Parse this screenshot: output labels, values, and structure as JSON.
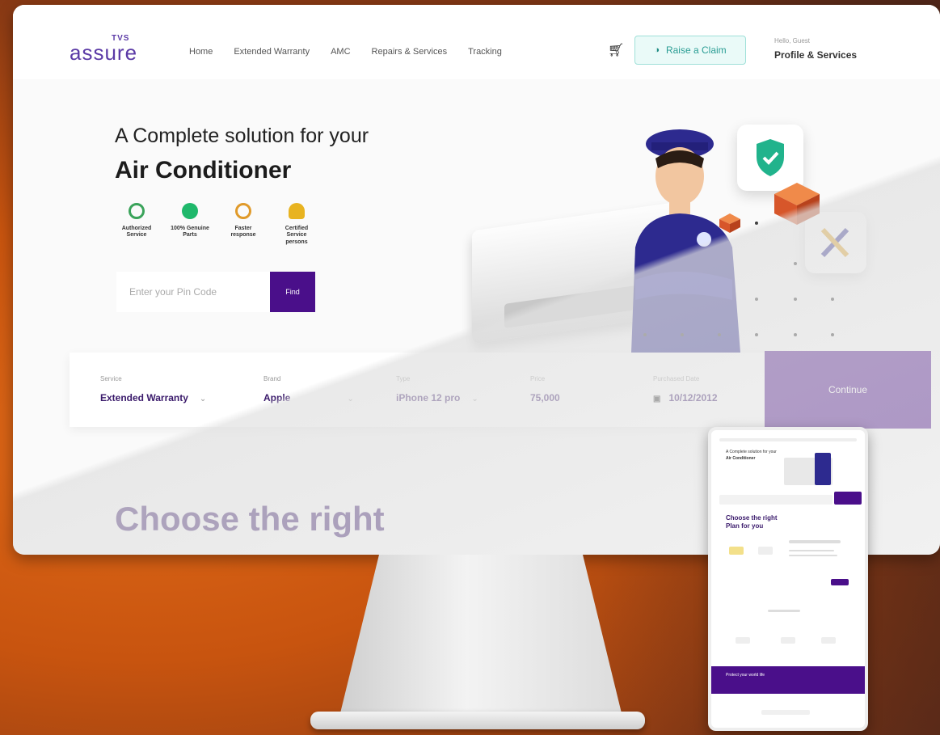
{
  "nav": {
    "logo_top": "TVS",
    "logo_main": "assure",
    "links": [
      "Home",
      "Extended Warranty",
      "AMC",
      "Repairs & Services",
      "Tracking"
    ],
    "claim_label": "Raise a Claim",
    "profile_hello": "Hello, Guest",
    "profile_label": "Profile & Services"
  },
  "hero": {
    "line1": "A Complete solution for your",
    "line2": "Air Conditioner",
    "features": [
      {
        "label": "Authorized Service",
        "color": "#3aa35a",
        "icon": "check-circle-icon"
      },
      {
        "label": "100% Genuine Parts",
        "color": "#1fb86b",
        "icon": "badge-icon"
      },
      {
        "label": "Faster response",
        "color": "#e09a2a",
        "icon": "stopwatch-icon"
      },
      {
        "label": "Certified Service persons",
        "color": "#e8b320",
        "icon": "medal-icon"
      }
    ],
    "pin_placeholder": "Enter your Pin Code",
    "find_label": "Find"
  },
  "form": {
    "fields": [
      {
        "label": "Service",
        "value": "Extended Warranty"
      },
      {
        "label": "Brand",
        "value": "Apple"
      },
      {
        "label": "Type",
        "value": "iPhone 12 pro"
      },
      {
        "label": "Price",
        "value": "75,000"
      },
      {
        "label": "Purchased Date",
        "value": "10/12/2012"
      }
    ],
    "continue_label": "Continue"
  },
  "section": {
    "choose_title": "Choose the right"
  },
  "phone": {
    "hero_line1": "A Complete solution for your",
    "hero_line2": "Air Conditioner",
    "choose_title": "Choose the right Plan for you",
    "footer_text": "Protect your world life"
  },
  "colors": {
    "brand_purple": "#4a0f8a",
    "title_purple": "#3a1a6b",
    "claim_teal": "#2a9d94"
  }
}
